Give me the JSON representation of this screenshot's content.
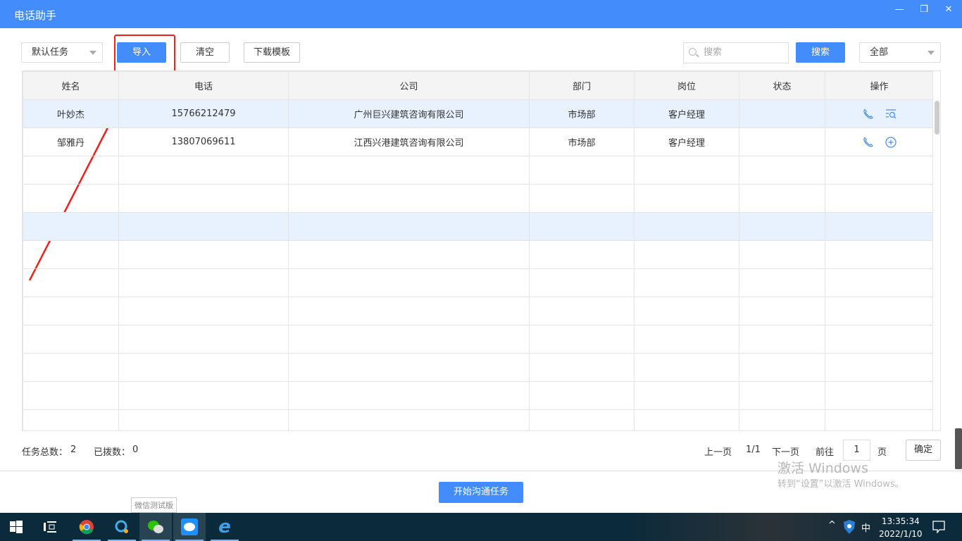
{
  "window": {
    "title": "电话助手"
  },
  "toolbar": {
    "task_select": "默认任务",
    "import": "导入",
    "clear": "清空",
    "download_template": "下载模板",
    "search_placeholder": "搜索",
    "search_button": "搜索",
    "filter_select": "全部"
  },
  "table": {
    "headers": [
      "姓名",
      "电话",
      "公司",
      "部门",
      "岗位",
      "状态",
      "操作"
    ],
    "rows": [
      {
        "name": "叶妙杰",
        "phone": "15766212479",
        "company": "广州巨兴建筑咨询有限公司",
        "dept": "市场部",
        "position": "客户经理",
        "status": "",
        "actions": [
          "phone-icon",
          "list-search-icon"
        ]
      },
      {
        "name": "邹雅丹",
        "phone": "13807069611",
        "company": "江西兴港建筑咨询有限公司",
        "dept": "市场部",
        "position": "客户经理",
        "status": "",
        "actions": [
          "phone-icon",
          "add-circle-icon"
        ]
      }
    ]
  },
  "footer": {
    "total_label": "任务总数：",
    "total": "2",
    "dialed_label": "已拨数：",
    "dialed": "0"
  },
  "pager": {
    "prev": "上一页",
    "page_info": "1/1",
    "next": "下一页",
    "goto": "前往",
    "page_value": "1",
    "page_unit": "页",
    "confirm": "确定"
  },
  "start_button": "开始沟通任务",
  "watermark": {
    "line1": "激活 Windows",
    "line2": "转到“设置”以激活 Windows。"
  },
  "taskbar": {
    "tooltip": "微信测试版",
    "time": "13:35:34",
    "date": "2022/1/10",
    "ime": "中"
  },
  "colors": {
    "accent": "#438cfb",
    "annotation": "#f0201a"
  }
}
